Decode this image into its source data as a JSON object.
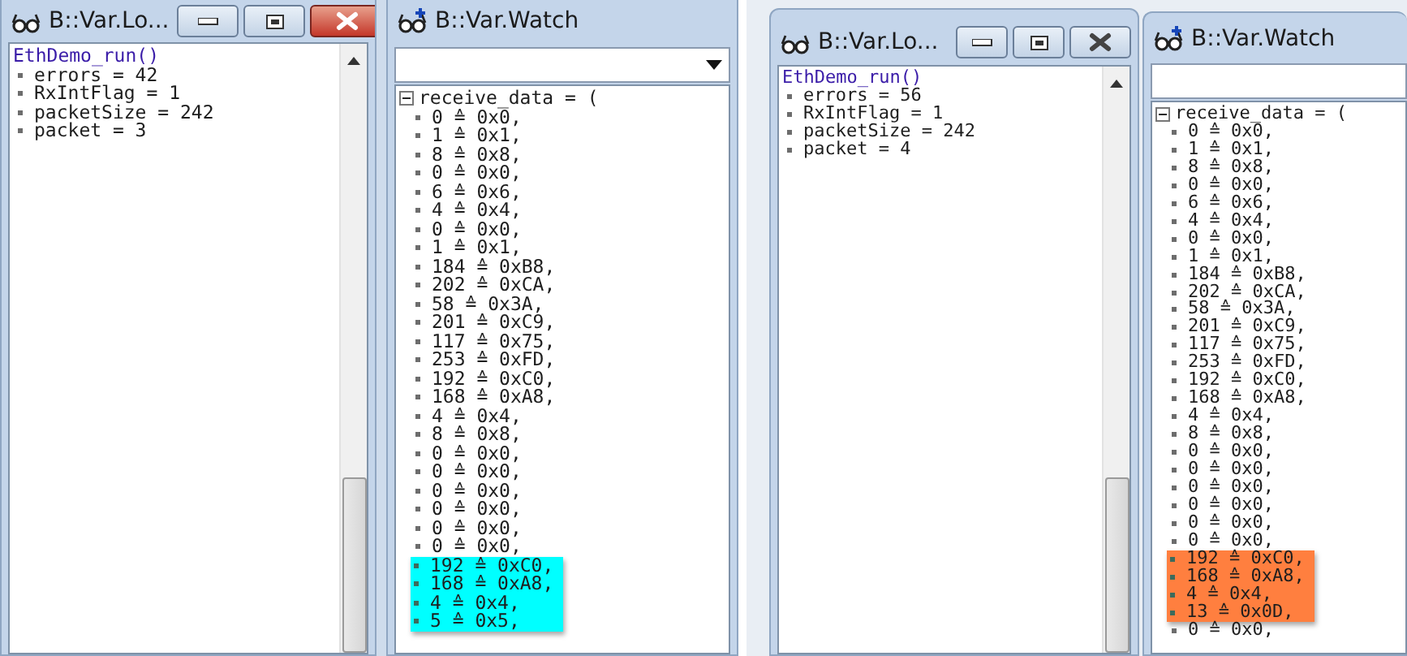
{
  "screenshots": [
    {
      "locals": {
        "title": "B::Var.Lo...",
        "active": true,
        "function": "EthDemo_run()",
        "variables": [
          "errors = 42",
          "RxIntFlag = 1",
          "packetSize = 242",
          "packet = 3"
        ]
      },
      "watch": {
        "title": "B::Var.Watch",
        "dropdown_arrow": true,
        "expression": "receive_data = (",
        "color": "#00ffff",
        "items": [
          {
            "text": "0 ≙ 0x0,",
            "highlighted": false
          },
          {
            "text": "1 ≙ 0x1,",
            "highlighted": false
          },
          {
            "text": "8 ≙ 0x8,",
            "highlighted": false
          },
          {
            "text": "0 ≙ 0x0,",
            "highlighted": false
          },
          {
            "text": "6 ≙ 0x6,",
            "highlighted": false
          },
          {
            "text": "4 ≙ 0x4,",
            "highlighted": false
          },
          {
            "text": "0 ≙ 0x0,",
            "highlighted": false
          },
          {
            "text": "1 ≙ 0x1,",
            "highlighted": false
          },
          {
            "text": "184 ≙ 0xB8,",
            "highlighted": false
          },
          {
            "text": "202 ≙ 0xCA,",
            "highlighted": false
          },
          {
            "text": "58 ≙ 0x3A,",
            "highlighted": false
          },
          {
            "text": "201 ≙ 0xC9,",
            "highlighted": false
          },
          {
            "text": "117 ≙ 0x75,",
            "highlighted": false
          },
          {
            "text": "253 ≙ 0xFD,",
            "highlighted": false
          },
          {
            "text": "192 ≙ 0xC0,",
            "highlighted": false
          },
          {
            "text": "168 ≙ 0xA8,",
            "highlighted": false
          },
          {
            "text": "4 ≙ 0x4,",
            "highlighted": false
          },
          {
            "text": "8 ≙ 0x8,",
            "highlighted": false
          },
          {
            "text": "0 ≙ 0x0,",
            "highlighted": false
          },
          {
            "text": "0 ≙ 0x0,",
            "highlighted": false
          },
          {
            "text": "0 ≙ 0x0,",
            "highlighted": false
          },
          {
            "text": "0 ≙ 0x0,",
            "highlighted": false
          },
          {
            "text": "0 ≙ 0x0,",
            "highlighted": false
          },
          {
            "text": "0 ≙ 0x0,",
            "highlighted": false
          },
          {
            "text": "192 ≙ 0xC0,",
            "highlighted": true
          },
          {
            "text": "168 ≙ 0xA8,",
            "highlighted": true
          },
          {
            "text": "4 ≙ 0x4,",
            "highlighted": true
          },
          {
            "text": "5 ≙ 0x5,",
            "highlighted": true
          }
        ]
      }
    },
    {
      "locals": {
        "title": "B::Var.Lo...",
        "active": false,
        "function": "EthDemo_run()",
        "variables": [
          "errors = 56",
          "RxIntFlag = 1",
          "packetSize = 242",
          "packet = 4"
        ]
      },
      "watch": {
        "title": "B::Var.Watch",
        "dropdown_arrow": false,
        "expression": "receive_data = (",
        "color": "#ff7f3f",
        "items": [
          {
            "text": "0 ≙ 0x0,",
            "highlighted": false
          },
          {
            "text": "1 ≙ 0x1,",
            "highlighted": false
          },
          {
            "text": "8 ≙ 0x8,",
            "highlighted": false
          },
          {
            "text": "0 ≙ 0x0,",
            "highlighted": false
          },
          {
            "text": "6 ≙ 0x6,",
            "highlighted": false
          },
          {
            "text": "4 ≙ 0x4,",
            "highlighted": false
          },
          {
            "text": "0 ≙ 0x0,",
            "highlighted": false
          },
          {
            "text": "1 ≙ 0x1,",
            "highlighted": false
          },
          {
            "text": "184 ≙ 0xB8,",
            "highlighted": false
          },
          {
            "text": "202 ≙ 0xCA,",
            "highlighted": false
          },
          {
            "text": "58 ≙ 0x3A,",
            "highlighted": false
          },
          {
            "text": "201 ≙ 0xC9,",
            "highlighted": false
          },
          {
            "text": "117 ≙ 0x75,",
            "highlighted": false
          },
          {
            "text": "253 ≙ 0xFD,",
            "highlighted": false
          },
          {
            "text": "192 ≙ 0xC0,",
            "highlighted": false
          },
          {
            "text": "168 ≙ 0xA8,",
            "highlighted": false
          },
          {
            "text": "4 ≙ 0x4,",
            "highlighted": false
          },
          {
            "text": "8 ≙ 0x8,",
            "highlighted": false
          },
          {
            "text": "0 ≙ 0x0,",
            "highlighted": false
          },
          {
            "text": "0 ≙ 0x0,",
            "highlighted": false
          },
          {
            "text": "0 ≙ 0x0,",
            "highlighted": false
          },
          {
            "text": "0 ≙ 0x0,",
            "highlighted": false
          },
          {
            "text": "0 ≙ 0x0,",
            "highlighted": false
          },
          {
            "text": "0 ≙ 0x0,",
            "highlighted": false
          },
          {
            "text": "192 ≙ 0xC0,",
            "highlighted": true
          },
          {
            "text": "168 ≙ 0xA8,",
            "highlighted": true
          },
          {
            "text": "4 ≙ 0x4,",
            "highlighted": true
          },
          {
            "text": "13 ≙ 0x0D,",
            "highlighted": true
          },
          {
            "text": "0 ≙ 0x0,",
            "highlighted": false
          }
        ]
      }
    }
  ]
}
